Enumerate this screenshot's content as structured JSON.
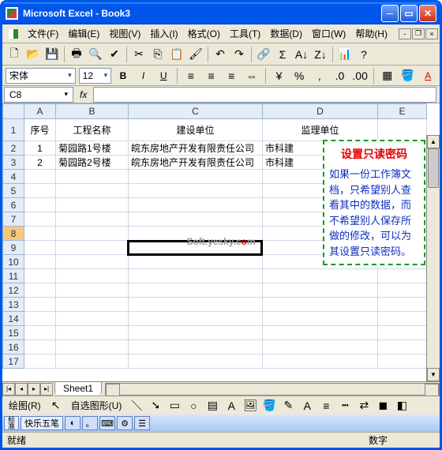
{
  "title": "Microsoft Excel - Book3",
  "menu": [
    "文件(F)",
    "编辑(E)",
    "视图(V)",
    "插入(I)",
    "格式(O)",
    "工具(T)",
    "数据(D)",
    "窗口(W)",
    "帮助(H)"
  ],
  "font": {
    "name": "宋体",
    "size": "12"
  },
  "namebox": "C8",
  "fx": "fx",
  "columns": [
    "A",
    "B",
    "C",
    "D",
    "E"
  ],
  "headers": {
    "A": "序号",
    "B": "工程名称",
    "C": "建设单位",
    "D": "监理单位"
  },
  "rows": [
    {
      "n": "1",
      "A": "1",
      "B": "菊园路1号楼",
      "C": "皖东房地产开发有限责任公司",
      "D": "市科建"
    },
    {
      "n": "2",
      "A": "2",
      "B": "菊园路2号楼",
      "C": "皖东房地产开发有限责任公司",
      "D": "市科建"
    }
  ],
  "row_labels": [
    "1",
    "2",
    "3",
    "4",
    "5",
    "6",
    "7",
    "8",
    "9",
    "10",
    "11",
    "12",
    "13",
    "14",
    "15",
    "16",
    "17"
  ],
  "callout": {
    "title": "设置只读密码",
    "body": "如果一份工作簿文档，只希望别人查看其中的数据，而不希望别人保存所做的修改，可以为其设置只读密码。"
  },
  "watermark": "Soft.yesky.c",
  "watermark_suffix": "m",
  "sheet": "Sheet1",
  "draw_label": "绘图(R)",
  "autoshape": "自选图形(U)",
  "ime": "快乐五笔",
  "status": "就绪",
  "status_right": "数字"
}
